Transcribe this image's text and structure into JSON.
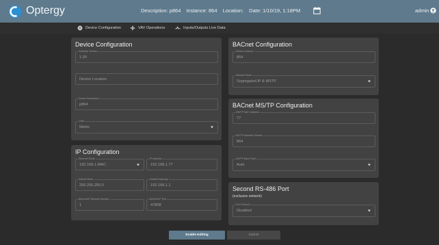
{
  "header": {
    "brand": "Optergy",
    "description_label": "Description: p864",
    "instance_label": "Instance: 864",
    "location_label": "Location:",
    "date_label": "Date: 1/10/19, 1:18PM",
    "user": "admin",
    "brand_color": "#5e7a8c"
  },
  "tabs": [
    {
      "label": "Device Configuration",
      "icon": "gear-icon",
      "active": true
    },
    {
      "label": "VAV Operations",
      "icon": "fan-icon",
      "active": false
    },
    {
      "label": "Inputs/Outputs Live Data",
      "icon": "inputs-outputs-icon",
      "active": false
    }
  ],
  "device_config": {
    "title": "Device Configuration",
    "software_version_label": "Software Version",
    "software_version": "1.00",
    "device_location_placeholder": "Device Location",
    "device_description_label": "Device Description",
    "device_description": "p864",
    "units_label": "Units",
    "units": "Metric"
  },
  "ip_config": {
    "title": "IP Configuration",
    "ethernet_mode_label": "Ethernet Mode",
    "ethernet_mode": "192.168.1.MAC",
    "ip_address_label": "IP Address",
    "ip_address": "192.168.1.77",
    "subnet_mask_label": "Subnet Mask",
    "subnet_mask": "255.255.255.0",
    "default_gateway_label": "Default Gateway",
    "default_gateway": "192.168.1.1",
    "bacnet_ip_network_label": "BACnet/IP Network Number",
    "bacnet_ip_network": "1",
    "bacnet_ip_port_label": "BACnet IP Port",
    "bacnet_ip_port": "47808"
  },
  "bacnet_config": {
    "title": "BACnet Configuration",
    "device_instance_label": "Device Instance",
    "device_instance": "864",
    "network_mode_label": "Network Mode",
    "network_mode": "Segregated IP & MSTP"
  },
  "mstp_config": {
    "title": "BACnet MS/TP Configuration",
    "mac_address_label": "MS/TP MAC Address",
    "mac_address": "77",
    "network_number_label": "MS/TP Network Number",
    "network_number": "864",
    "baud_rate_label": "MS/TP Baud Rate",
    "baud_rate": "Auto"
  },
  "rs485": {
    "title": "Second RS-486 Port",
    "subtitle": "(exclusive network)",
    "port_protocol_label": "Port Protocol",
    "port_protocol": "Disabled"
  },
  "actions": {
    "enable_editing": "Enable Editing",
    "submit": "Submit"
  }
}
